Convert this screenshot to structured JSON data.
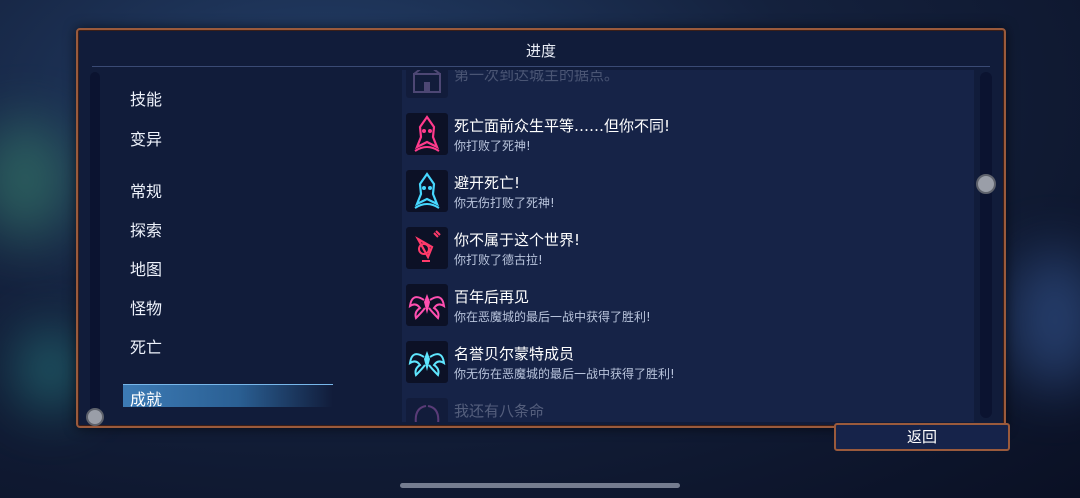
{
  "panel": {
    "title": "进度"
  },
  "categories": [
    {
      "label": "技能"
    },
    {
      "label": "变异"
    },
    {
      "label": "常规"
    },
    {
      "label": "探索"
    },
    {
      "label": "地图"
    },
    {
      "label": "怪物"
    },
    {
      "label": "死亡"
    }
  ],
  "active_category": {
    "label": "成就"
  },
  "achievements": [
    {
      "title": "第一次到达城主的据点。",
      "desc": "",
      "icon": "castle-icon",
      "color": "#7a5a8a"
    },
    {
      "title": "死亡面前众生平等……但你不同!",
      "desc": "你打败了死神!",
      "icon": "death-skull-icon",
      "color": "#ff3a8c"
    },
    {
      "title": "避开死亡!",
      "desc": "你无伤打败了死神!",
      "icon": "death-skull-cyan-icon",
      "color": "#46d8ff"
    },
    {
      "title": "你不属于这个世界!",
      "desc": "你打败了德古拉!",
      "icon": "dracula-goblet-icon",
      "color": "#ff3a6a"
    },
    {
      "title": "百年后再见",
      "desc": "你在恶魔城的最后一战中获得了胜利!",
      "icon": "demon-wings-icon",
      "color": "#ff4fb0"
    },
    {
      "title": "名誉贝尔蒙特成员",
      "desc": "你无伤在恶魔城的最后一战中获得了胜利!",
      "icon": "demon-wings-cyan-icon",
      "color": "#5fe6ff"
    },
    {
      "title": "我还有八条命",
      "desc": "",
      "icon": "wings-icon",
      "color": "#d86ad0"
    }
  ],
  "buttons": {
    "back_label": "返回"
  }
}
